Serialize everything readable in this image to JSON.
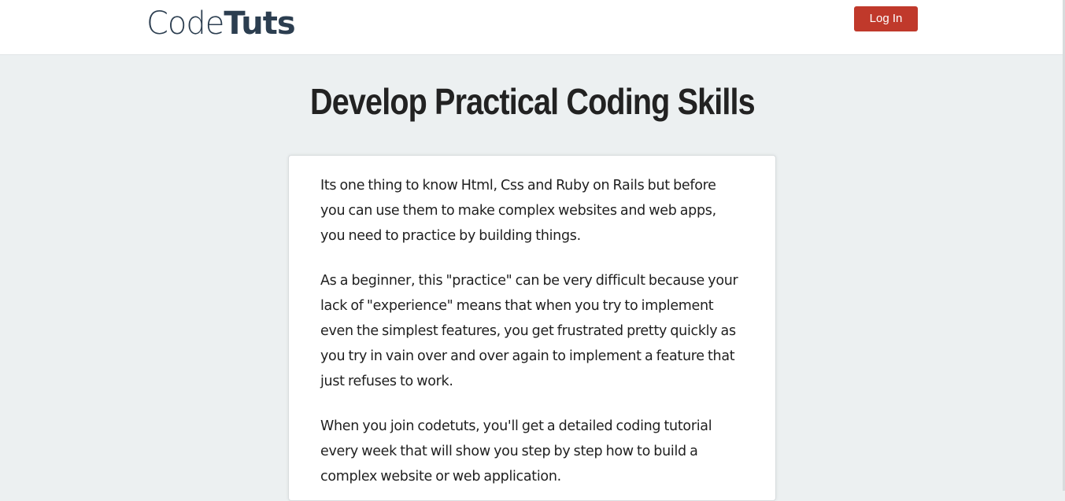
{
  "navbar": {
    "brand_light": "Code",
    "brand_bold": "Tuts",
    "login_label": "Log In"
  },
  "hero": {
    "title": "Develop Practical Coding Skills"
  },
  "card": {
    "paragraphs": [
      "Its one thing to know Html, Css and Ruby on Rails but before you can use them to make complex websites and web apps, you need to practice by building things.",
      "As a beginner, this \"practice\" can be very difficult because your lack of \"experience\" means that when you try to implement even the simplest features, you get frustrated pretty quickly as you try in vain over and over again to implement a feature that just refuses to work.",
      "When you join codetuts, you'll get a detailed coding tutorial every week that will show you step by step how to build a complex website or web application."
    ]
  },
  "colors": {
    "page_background": "#ecf0f1",
    "login_button": "#c0392b",
    "brand_text": "#2c3e50"
  }
}
